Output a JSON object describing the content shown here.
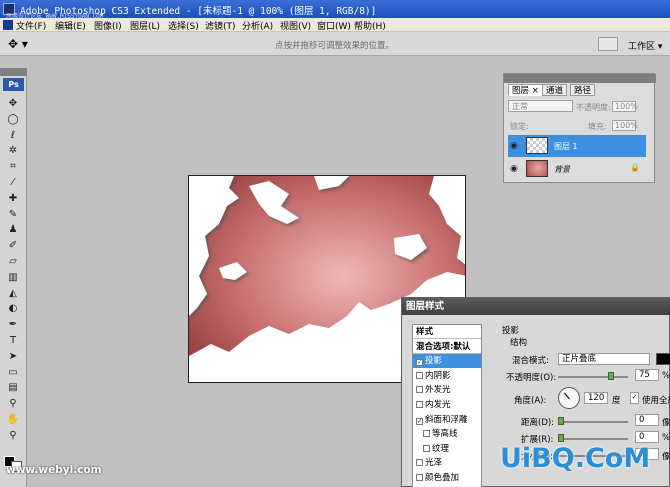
{
  "titlebar": {
    "title": "Adobe Photoshop CS3 Extended - [未标题-1 @ 100% (图层 1, RGB/8)]",
    "watermark": "思缘设计论坛 WWW.MISSYUAN.COM"
  },
  "menu": [
    "文件(F)",
    "编辑(E)",
    "图像(I)",
    "图层(L)",
    "选择(S)",
    "滤镜(T)",
    "分析(A)",
    "视图(V)",
    "窗口(W)",
    "帮助(H)"
  ],
  "options": {
    "tool_icon": "move-tool-icon",
    "hint": "点按并拖移可调整效果的位置。",
    "workspace": "工作区 ▾"
  },
  "toolbox": {
    "logo": "Ps",
    "tools": [
      {
        "icon": "move-icon",
        "glyph": "✥"
      },
      {
        "icon": "marquee-icon",
        "glyph": "◯"
      },
      {
        "icon": "lasso-icon",
        "glyph": "ℓ"
      },
      {
        "icon": "magic-wand-icon",
        "glyph": "✲"
      },
      {
        "icon": "crop-icon",
        "glyph": "⌗"
      },
      {
        "icon": "slice-icon",
        "glyph": "⁄"
      },
      {
        "icon": "healing-icon",
        "glyph": "✚"
      },
      {
        "icon": "brush-icon",
        "glyph": "✎"
      },
      {
        "icon": "stamp-icon",
        "glyph": "♟"
      },
      {
        "icon": "history-brush-icon",
        "glyph": "✐"
      },
      {
        "icon": "eraser-icon",
        "glyph": "▱"
      },
      {
        "icon": "gradient-icon",
        "glyph": "▥"
      },
      {
        "icon": "blur-icon",
        "glyph": "◭"
      },
      {
        "icon": "dodge-icon",
        "glyph": "◐"
      },
      {
        "icon": "pen-icon",
        "glyph": "✒"
      },
      {
        "icon": "type-icon",
        "glyph": "T"
      },
      {
        "icon": "path-select-icon",
        "glyph": "➤"
      },
      {
        "icon": "shape-icon",
        "glyph": "▭"
      },
      {
        "icon": "notes-icon",
        "glyph": "▤"
      },
      {
        "icon": "eyedropper-icon",
        "glyph": "⚲"
      },
      {
        "icon": "hand-icon",
        "glyph": "✋"
      },
      {
        "icon": "zoom-icon",
        "glyph": "⚲"
      }
    ]
  },
  "layers_panel": {
    "tabs": [
      "图层 ×",
      "通道",
      "路径"
    ],
    "blend_mode": "正常",
    "opacity_label": "不透明度:",
    "opacity_value": "100%",
    "lock_label": "锁定:",
    "fill_label": "填充:",
    "fill_value": "100%",
    "layers": [
      {
        "name": "图层 1",
        "selected": true
      },
      {
        "name": "背景",
        "selected": false,
        "locked": true
      }
    ]
  },
  "dialog": {
    "title": "图层样式",
    "list": [
      {
        "label": "样式",
        "type": "head"
      },
      {
        "label": "混合选项:默认",
        "type": "head"
      },
      {
        "label": "投影",
        "checked": true,
        "selected": true
      },
      {
        "label": "内阴影",
        "checked": false
      },
      {
        "label": "外发光",
        "checked": false
      },
      {
        "label": "内发光",
        "checked": false
      },
      {
        "label": "斜面和浮雕",
        "checked": true
      },
      {
        "label": "等高线",
        "checked": false,
        "indent": true
      },
      {
        "label": "纹理",
        "checked": false,
        "indent": true
      },
      {
        "label": "光泽",
        "checked": false
      },
      {
        "label": "颜色叠加",
        "checked": false
      }
    ],
    "section_title": "投影",
    "structure_title": "结构",
    "blend_label": "混合模式:",
    "blend_value": "正片叠底",
    "opacity_label": "不透明度(O):",
    "opacity_value": "75",
    "percent": "%",
    "angle_label": "角度(A):",
    "angle_value": "120",
    "angle_unit": "度",
    "global_light": "使用全局",
    "distance_label": "距离(D):",
    "distance_value": "0",
    "spread_label": "扩展(R):",
    "spread_value": "0",
    "size_label": "大小(S):",
    "unit_px": "像"
  },
  "watermarks": {
    "left": "www.webyi.com",
    "right": "UiBQ.CoM"
  },
  "colors": {
    "selection_blue": "#3d8fe0",
    "canvas_red": "#b55a5a"
  }
}
